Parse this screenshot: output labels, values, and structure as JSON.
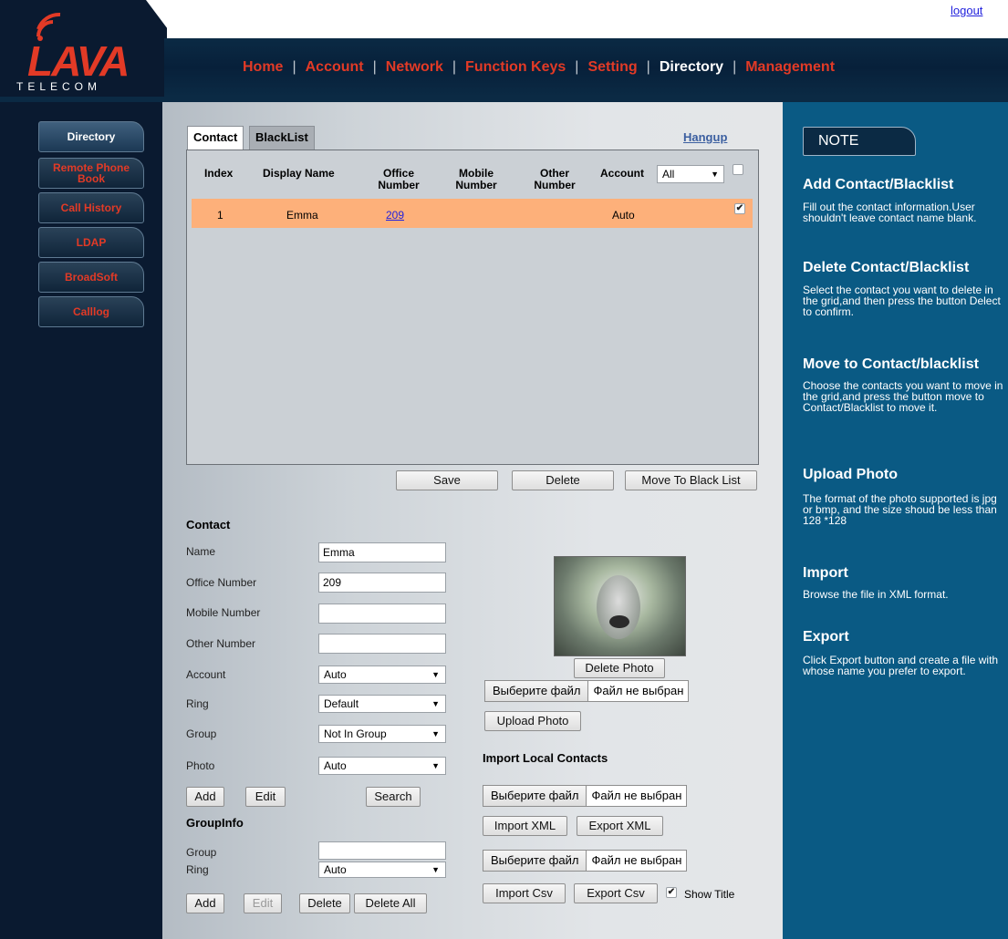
{
  "header": {
    "logo_word": "LAVA",
    "logo_sub": "TELECOM",
    "logout": "logout",
    "nav": [
      {
        "label": "Home"
      },
      {
        "label": "Account"
      },
      {
        "label": "Network"
      },
      {
        "label": "Function Keys"
      },
      {
        "label": "Setting"
      },
      {
        "label": "Directory",
        "active": true
      },
      {
        "label": "Management"
      }
    ]
  },
  "sidebar": {
    "items": [
      {
        "label": "Directory",
        "active": true
      },
      {
        "label": "Remote Phone Book"
      },
      {
        "label": "Call History"
      },
      {
        "label": "LDAP"
      },
      {
        "label": "BroadSoft"
      },
      {
        "label": "Calllog"
      }
    ]
  },
  "tabs": {
    "contact": "Contact",
    "blacklist": "BlackList",
    "hangup": "Hangup"
  },
  "grid": {
    "headers": {
      "index": "Index",
      "display_name": "Display Name",
      "office_number": "Office Number",
      "mobile_number": "Mobile Number",
      "other_number": "Other Number",
      "account": "Account"
    },
    "account_filter": "All",
    "rows": [
      {
        "index": "1",
        "display_name": "Emma",
        "office_number": "209",
        "mobile_number": "",
        "other_number": "",
        "account": "Auto",
        "checked": true
      }
    ]
  },
  "grid_buttons": {
    "save": "Save",
    "delete": "Delete",
    "move": "Move To Black List"
  },
  "contact_form": {
    "title": "Contact",
    "name_label": "Name",
    "name_value": "Emma",
    "office_label": "Office Number",
    "office_value": "209",
    "mobile_label": "Mobile Number",
    "mobile_value": "",
    "other_label": "Other Number",
    "other_value": "",
    "account_label": "Account",
    "account_value": "Auto",
    "ring_label": "Ring",
    "ring_value": "Default",
    "group_label": "Group",
    "group_value": "Not In Group",
    "photo_label": "Photo",
    "photo_value": "Auto",
    "add": "Add",
    "edit": "Edit",
    "search": "Search"
  },
  "group_info": {
    "title": "GroupInfo",
    "group_label": "Group",
    "group_value": "",
    "ring_label": "Ring",
    "ring_value": "Auto",
    "add": "Add",
    "edit": "Edit",
    "delete": "Delete",
    "delete_all": "Delete All"
  },
  "photo_section": {
    "delete_photo": "Delete Photo",
    "choose_file": "Выберите файл",
    "no_file": "Файл не выбран",
    "upload_photo": "Upload Photo"
  },
  "import_section": {
    "title": "Import Local Contacts",
    "choose_file": "Выберите файл",
    "no_file": "Файл не выбран",
    "import_xml": "Import XML",
    "export_xml": "Export XML",
    "import_csv": "Import Csv",
    "export_csv": "Export Csv",
    "show_title": "Show Title",
    "show_title_checked": true
  },
  "note": {
    "tab": "NOTE",
    "sections": [
      {
        "title": "Add Contact/Blacklist",
        "text": "Fill out the contact information.User shouldn't leave contact name blank."
      },
      {
        "title": "Delete Contact/Blacklist",
        "text": "Select the contact you want to delete in the grid,and then press the button Delect to confirm."
      },
      {
        "title": "Move to Contact/blacklist",
        "text": "Choose the contacts you want to move in the grid,and press the button move to Contact/Blacklist to move it."
      },
      {
        "title": "Upload Photo",
        "text": "The format of the photo supported is jpg or bmp, and the size shoud be less than 128 *128"
      },
      {
        "title": "Import",
        "text": "Browse the file in XML format."
      },
      {
        "title": "Export",
        "text": "Click Export button and create a file with whose name you prefer to export."
      }
    ]
  },
  "colors": {
    "accent_red": "#e23a26",
    "navy": "#0a1a30",
    "note_blue": "#0a5a84",
    "row_highlight": "#fdb07a"
  }
}
